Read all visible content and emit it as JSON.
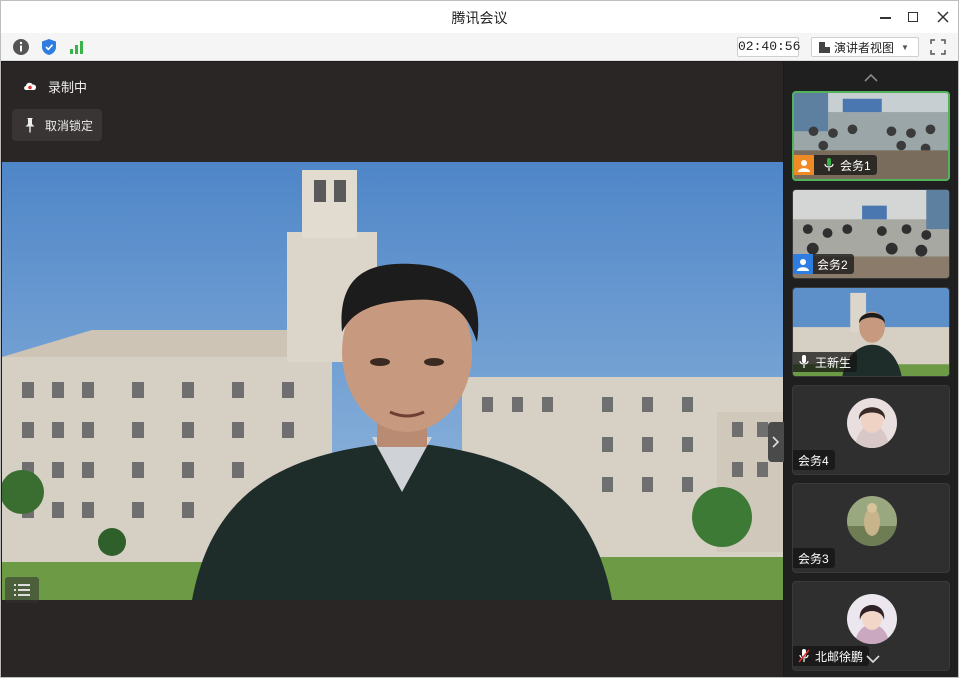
{
  "window": {
    "title": "腾讯会议"
  },
  "toolbar": {
    "timer": "02:40:56",
    "view_label": "演讲者视图",
    "icons": [
      "info-icon",
      "shield-icon",
      "signal-icon",
      "fullscreen-icon"
    ]
  },
  "stage": {
    "recording_label": "录制中",
    "unpin_label": "取消锁定"
  },
  "participants": [
    {
      "name": "会务1",
      "avatar_color": "#f08a24",
      "mic": "on-green",
      "active": true
    },
    {
      "name": "会务2",
      "avatar_color": "#2f7de1",
      "mic": "none",
      "active": false
    },
    {
      "name": "王新生",
      "mic": "on-white",
      "active": false
    },
    {
      "name": "会务4",
      "mic": "none",
      "active": false
    },
    {
      "name": "会务3",
      "mic": "none",
      "active": false
    },
    {
      "name": "北邮徐鹏",
      "mic": "muted",
      "active": false
    }
  ],
  "colors": {
    "active_border": "#52b35a",
    "signal_green": "#3bb14a",
    "shield_blue": "#2f7de1",
    "stage_bg": "#2b2626",
    "sidebar_bg": "#1f1f1f"
  }
}
